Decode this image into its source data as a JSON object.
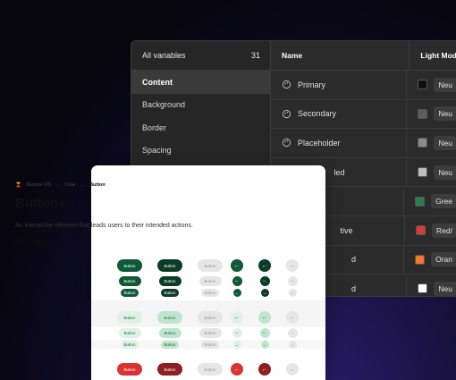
{
  "variables_panel": {
    "sidebar_title": "All variables",
    "sidebar_count": "31",
    "groups": [
      "Content",
      "Background",
      "Border",
      "Spacing"
    ],
    "active_group": "Content",
    "col_name": "Name",
    "col_mode": "Light Mod",
    "rows": [
      {
        "name": "Primary",
        "swatch": "#111111",
        "value": "Neu"
      },
      {
        "name": "Secondary",
        "swatch": "#5c5c5c",
        "value": "Neu"
      },
      {
        "name": "Placeholder",
        "swatch": "#8a8a8a",
        "value": "Neu"
      },
      {
        "name": "Disabled",
        "swatch": "#bdbdbd",
        "value": "Neu"
      },
      {
        "name": "",
        "swatch": "#2e7d4f",
        "value": "Gree"
      },
      {
        "name": "Negative",
        "swatch": "#d83a3a",
        "value": "Red/"
      },
      {
        "name": "",
        "swatch": "#f07a2a",
        "value": "Oran"
      },
      {
        "name": "Inverted",
        "swatch": "#ffffff",
        "value": "Neu"
      }
    ],
    "row_name_labels": [
      "Primary",
      "Secondary",
      "Placeholder",
      "Dis           led",
      "",
      "                   tive",
      "                        d",
      "                        d"
    ]
  },
  "doc": {
    "breadcrumb": [
      "Slurpee DS",
      "Core",
      "Button"
    ],
    "title": "Buttons",
    "description": "An interactive element that leads users to their intended actions.",
    "section": "Button Component",
    "button_label": "Button",
    "arrow_glyph": "←",
    "colors": {
      "green_dark": "#0f5a36",
      "green_darker": "#0b3d25",
      "green_light": "#dff2e6",
      "green_light2": "#bfe6cd",
      "gray_btn": "#e6e6e6",
      "red": "#d93434",
      "red_dark": "#8f1f22"
    }
  }
}
